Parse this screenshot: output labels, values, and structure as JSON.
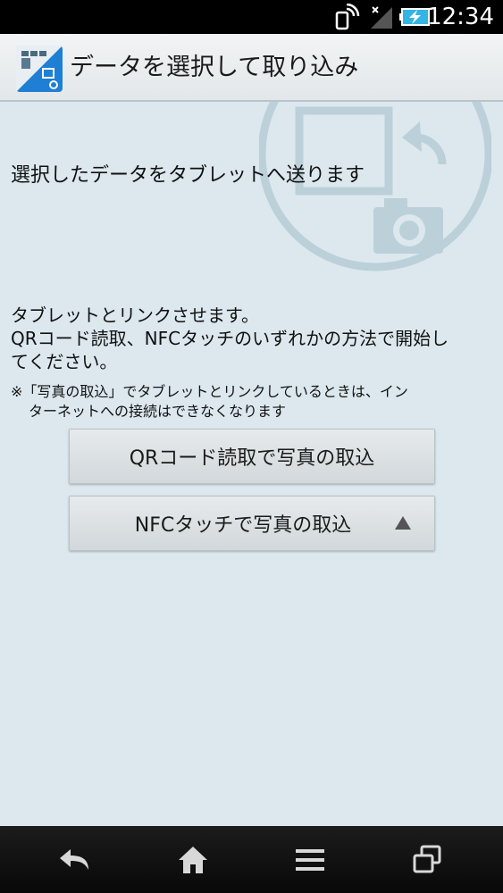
{
  "status_bar": {
    "time": "12:34",
    "icons": [
      "nfc-icon",
      "signal-icon",
      "battery-charging-icon"
    ]
  },
  "action_bar": {
    "title": "データを選択して取り込み",
    "app_icon": "photo-transfer-app-icon"
  },
  "main": {
    "headline": "選択したデータをタブレットへ送ります",
    "body_lines": [
      "タブレットとリンクさせます。",
      "QRコード読取、NFCタッチのいずれかの方法で開始し",
      "てください。"
    ],
    "note_line1": "※「写真の取込」でタブレットとリンクしているときは、イン",
    "note_line2": "ターネットへの接続はできなくなります",
    "background_graphic": "tablet-camera-transfer-icon"
  },
  "buttons": {
    "qr_label": "QRコード読取で写真の取込",
    "nfc_label": "NFCタッチで写真の取込"
  },
  "nav_bar": {
    "icons": [
      "back-icon",
      "home-icon",
      "menu-icon",
      "recent-apps-icon"
    ]
  },
  "colors": {
    "background": "#dce8ee",
    "action_bar": "#eceff1",
    "button": "#dde2e5",
    "graphic": "#bcd0da"
  }
}
